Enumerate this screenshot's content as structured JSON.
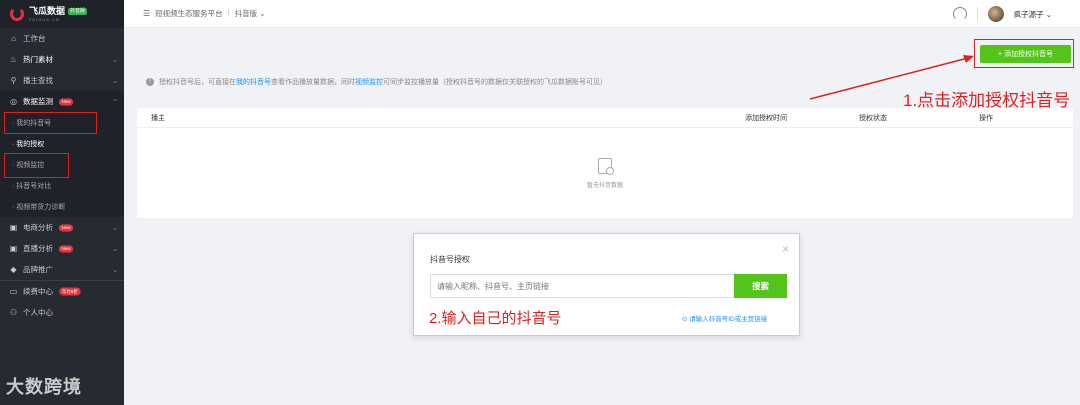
{
  "brand": {
    "name": "飞瓜数据",
    "badge": "抖音版",
    "sub": "FEIGUA.CN"
  },
  "sidebar": {
    "items": [
      {
        "icon": "home-icon",
        "glyph": "⌂",
        "label": "工作台"
      },
      {
        "icon": "fire-icon",
        "glyph": "♨",
        "label": "热门素材"
      },
      {
        "icon": "search-icon",
        "glyph": "⚲",
        "label": "播主查找"
      },
      {
        "icon": "monitor-icon",
        "glyph": "◎",
        "label": "数据监测",
        "badge": "New"
      }
    ],
    "sub_items": [
      "· 我的抖音号",
      "· 我的授权",
      "· 视频监控",
      "· 抖音号对比",
      "· 视频带货力诊断"
    ],
    "lower_items": [
      {
        "icon": "shop-icon",
        "glyph": "▣",
        "label": "电商分析",
        "badge": "New"
      },
      {
        "icon": "live-icon",
        "glyph": "▣",
        "label": "直播分析",
        "badge": "New"
      },
      {
        "icon": "diamond-icon",
        "glyph": "◆",
        "label": "品牌推广"
      },
      {
        "icon": "card-icon",
        "glyph": "▭",
        "label": "续费中心",
        "badge": "年付6折"
      },
      {
        "icon": "user-icon",
        "glyph": "⚇",
        "label": "个人中心"
      }
    ],
    "watermark": "大数跨境"
  },
  "topbar": {
    "menu_glyph": "☰",
    "crumb1": "短视频生态服务平台",
    "sep": "|",
    "crumb2": "抖音版 ⌄",
    "username": "疯子源子 ⌄"
  },
  "main": {
    "add_button": "+ 添加授权抖音号",
    "notice": {
      "prefix": "授权抖音号后，可直接在",
      "link1": "我的抖音号",
      "middle": "查看作品播放量数据，同时",
      "link2": "视频监控",
      "suffix": "可同步监控播放量（授权抖音号的数据仅关联授权的飞瓜数据账号可见）"
    },
    "table": {
      "headers": [
        "播主",
        "添加授权时间",
        "授权状态",
        "操作"
      ],
      "empty_text": "暂无抖音数据"
    }
  },
  "dialog": {
    "title": "抖音号授权",
    "close": "×",
    "placeholder": "请输入昵称、抖音号、主页链接",
    "search_button": "搜索",
    "note": "2.输入自己的抖音号",
    "link": "⊙ 请输入抖音号ID或主页链接"
  },
  "annotation": {
    "text": "1.点击添加授权抖音号"
  },
  "colors": {
    "accent": "#52c41a",
    "highlight": "#e02020",
    "sidebar": "#262a33"
  }
}
